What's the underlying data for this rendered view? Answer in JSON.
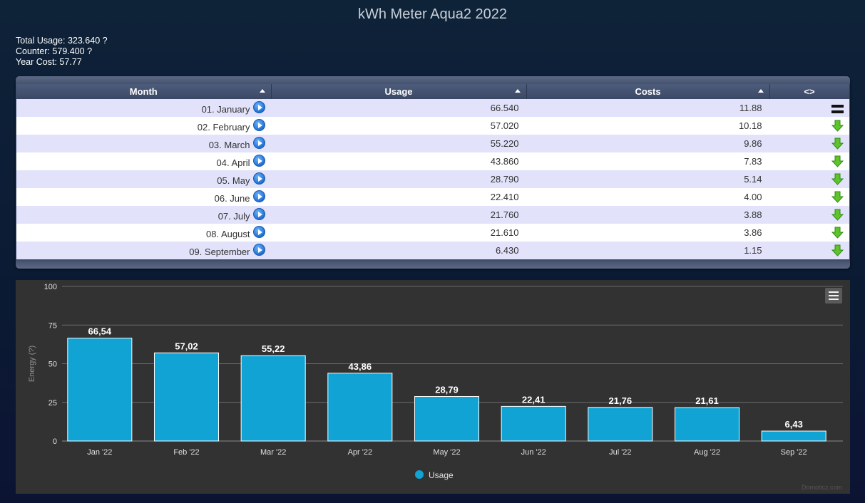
{
  "page": {
    "title": "kWh Meter Aqua2 2022",
    "total_usage": "Total Usage: 323.640 ?",
    "counter": "Counter: 579.400 ?",
    "year_cost": "Year Cost: 57.77"
  },
  "table": {
    "headers": [
      "Month",
      "Usage",
      "Costs",
      "<>"
    ],
    "rows": [
      {
        "month": "01. January",
        "usage": "66.540",
        "costs": "11.88",
        "trend": "equal"
      },
      {
        "month": "02. February",
        "usage": "57.020",
        "costs": "10.18",
        "trend": "down"
      },
      {
        "month": "03. March",
        "usage": "55.220",
        "costs": "9.86",
        "trend": "down"
      },
      {
        "month": "04. April",
        "usage": "43.860",
        "costs": "7.83",
        "trend": "down"
      },
      {
        "month": "05. May",
        "usage": "28.790",
        "costs": "5.14",
        "trend": "down"
      },
      {
        "month": "06. June",
        "usage": "22.410",
        "costs": "4.00",
        "trend": "down"
      },
      {
        "month": "07. July",
        "usage": "21.760",
        "costs": "3.88",
        "trend": "down"
      },
      {
        "month": "08. August",
        "usage": "21.610",
        "costs": "3.86",
        "trend": "down"
      },
      {
        "month": "09. September",
        "usage": "6.430",
        "costs": "1.15",
        "trend": "down"
      }
    ]
  },
  "chart_data": {
    "type": "bar",
    "categories": [
      "Jan '22",
      "Feb '22",
      "Mar '22",
      "Apr '22",
      "May '22",
      "Jun '22",
      "Jul '22",
      "Aug '22",
      "Sep '22"
    ],
    "series": [
      {
        "name": "Usage",
        "values": [
          66.54,
          57.02,
          55.22,
          43.86,
          28.79,
          22.41,
          21.76,
          21.61,
          6.43
        ],
        "labels": [
          "66,54",
          "57,02",
          "55,22",
          "43,86",
          "28,79",
          "22,41",
          "21,76",
          "21,61",
          "6,43"
        ]
      }
    ],
    "ylabel": "Energy (?)",
    "ylim": [
      0,
      100
    ],
    "yticks": [
      "0",
      "25",
      "50",
      "75",
      "100"
    ],
    "grid": true,
    "legend": "bottom-center",
    "bar_color": "#11a3d4",
    "credit": "Domoticz.com"
  }
}
